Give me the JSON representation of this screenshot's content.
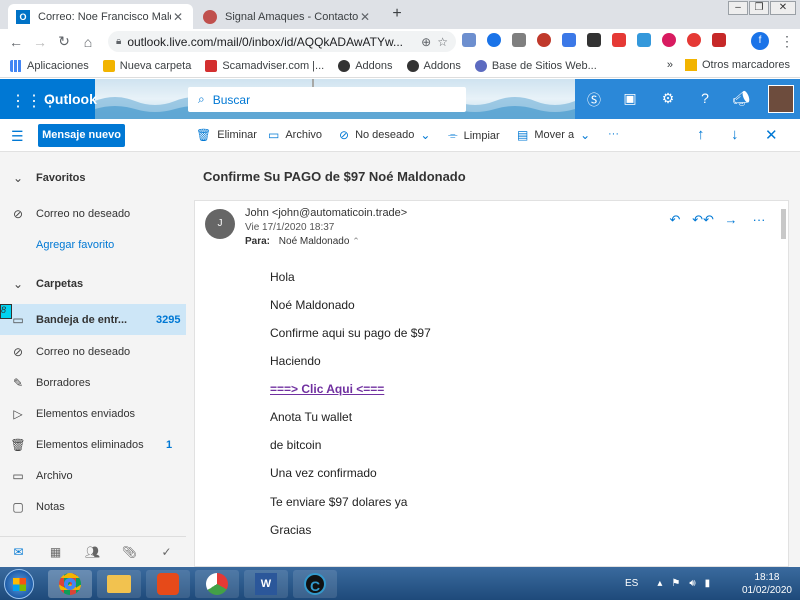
{
  "browser": {
    "tabs": [
      {
        "title": "Correo: Noe Francisco Maldonado",
        "favicon": "outlook-icon",
        "active": true
      },
      {
        "title": "Signal Amaques - Contacto y ave",
        "favicon": "chrome-globe-icon",
        "active": false
      }
    ],
    "new_tab": "+",
    "url": "outlook.live.com/mail/0/inbox/id/AQQkADAwATYw...",
    "bookmarks": [
      {
        "label": "Aplicaciones",
        "icon": "apps-grid-icon"
      },
      {
        "label": "Nueva carpeta",
        "icon": "folder-icon"
      },
      {
        "label": "Scamadviser.com |...",
        "icon": "shield-icon"
      },
      {
        "label": "Addons",
        "icon": "github-icon"
      },
      {
        "label": "Addons",
        "icon": "github-icon"
      },
      {
        "label": "Base de Sitios Web...",
        "icon": "globe-icon"
      }
    ],
    "other_bookmarks": "Otros marcadores",
    "profile_initial": "f",
    "overflow": "»"
  },
  "owa": {
    "brand": "Outlook",
    "search_placeholder": "Buscar",
    "new_message": "Mensaje nuevo",
    "commands": {
      "delete": "Eliminar",
      "archive": "Archivo",
      "junk": "No deseado",
      "sweep": "Limpiar",
      "move": "Mover a",
      "more": "···"
    }
  },
  "nav": {
    "favorites_header": "Favoritos",
    "fav_items": [
      {
        "label": "Correo no deseado",
        "icon": "block-icon"
      }
    ],
    "add_favorite": "Agregar favorito",
    "folders_header": "Carpetas",
    "folders": [
      {
        "label": "Bandeja de entr...",
        "icon": "inbox-icon",
        "count": "3295",
        "selected": true
      },
      {
        "label": "Correo no deseado",
        "icon": "block-icon",
        "count": ""
      },
      {
        "label": "Borradores",
        "icon": "pencil-icon",
        "count": ""
      },
      {
        "label": "Elementos enviados",
        "icon": "send-icon",
        "count": ""
      },
      {
        "label": "Elementos eliminados",
        "icon": "trash-icon",
        "count": "1"
      },
      {
        "label": "Archivo",
        "icon": "archive-icon",
        "count": ""
      },
      {
        "label": "Notas",
        "icon": "note-icon",
        "count": ""
      }
    ],
    "selected_marker": "8"
  },
  "message": {
    "subject": "Confirme Su PAGO de $97 Noé Maldonado",
    "sender_initial": "J",
    "from": "John <john@automaticoin.trade>",
    "date": "Vie 17/1/2020 18:37",
    "to_label": "Para:",
    "to": "Noé Maldonado",
    "body": [
      "Hola",
      "Noé Maldonado",
      "Confirme aqui su pago de $97",
      "Haciendo",
      "===> Clic Aqui <===",
      "Anota Tu wallet",
      "de bitcoin",
      "Una vez confirmado",
      "Te enviare $97 dolares ya",
      "Gracias"
    ]
  },
  "taskbar": {
    "language": "ES",
    "time": "18:18",
    "date": "01/02/2020"
  },
  "colors": {
    "outlook_blue": "#0078d4",
    "link_purple": "#7030a0",
    "nav_selected": "#cde6f7"
  }
}
